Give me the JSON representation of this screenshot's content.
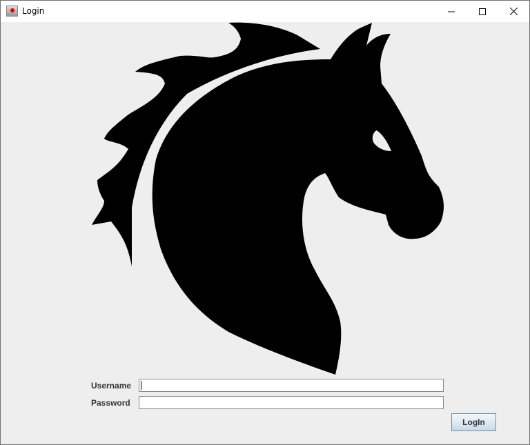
{
  "window": {
    "title": "Login",
    "app_icon": "java-app-icon",
    "controls": {
      "minimize": "minimize-icon",
      "maximize": "maximize-icon",
      "close": "close-icon"
    }
  },
  "logo": {
    "icon": "horse-head-logo",
    "color": "#000000"
  },
  "form": {
    "username_label": "Username",
    "username_value": "",
    "password_label": "Password",
    "password_value": "",
    "login_button": "LogIn"
  }
}
